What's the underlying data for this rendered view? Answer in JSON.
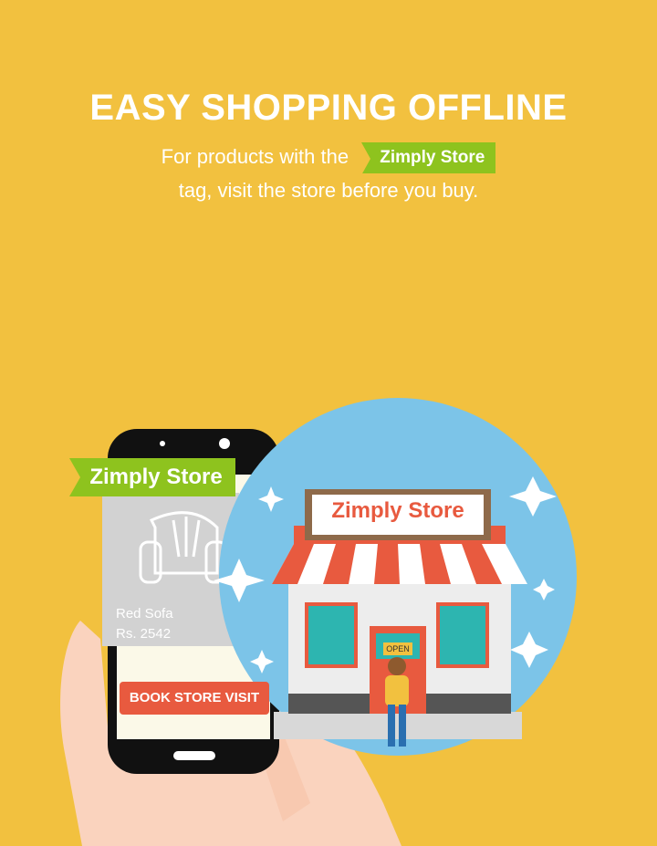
{
  "headline": "EASY SHOPPING OFFLINE",
  "subtitle": {
    "line1_prefix": "For products with the",
    "tag_label": "Zimply Store",
    "line2": "tag, visit the store before you buy."
  },
  "phone": {
    "tag_label": "Zimply Store",
    "product_name": "Red Sofa",
    "product_price": "Rs. 2542",
    "book_button": "BOOK STORE VISIT"
  },
  "store": {
    "sign": "Zimply Store",
    "door_sign": "OPEN"
  },
  "colors": {
    "background": "#F2C13F",
    "tag_green": "#8EC31E",
    "button_red": "#E85A3F",
    "circle_blue": "#7CC4E8"
  }
}
